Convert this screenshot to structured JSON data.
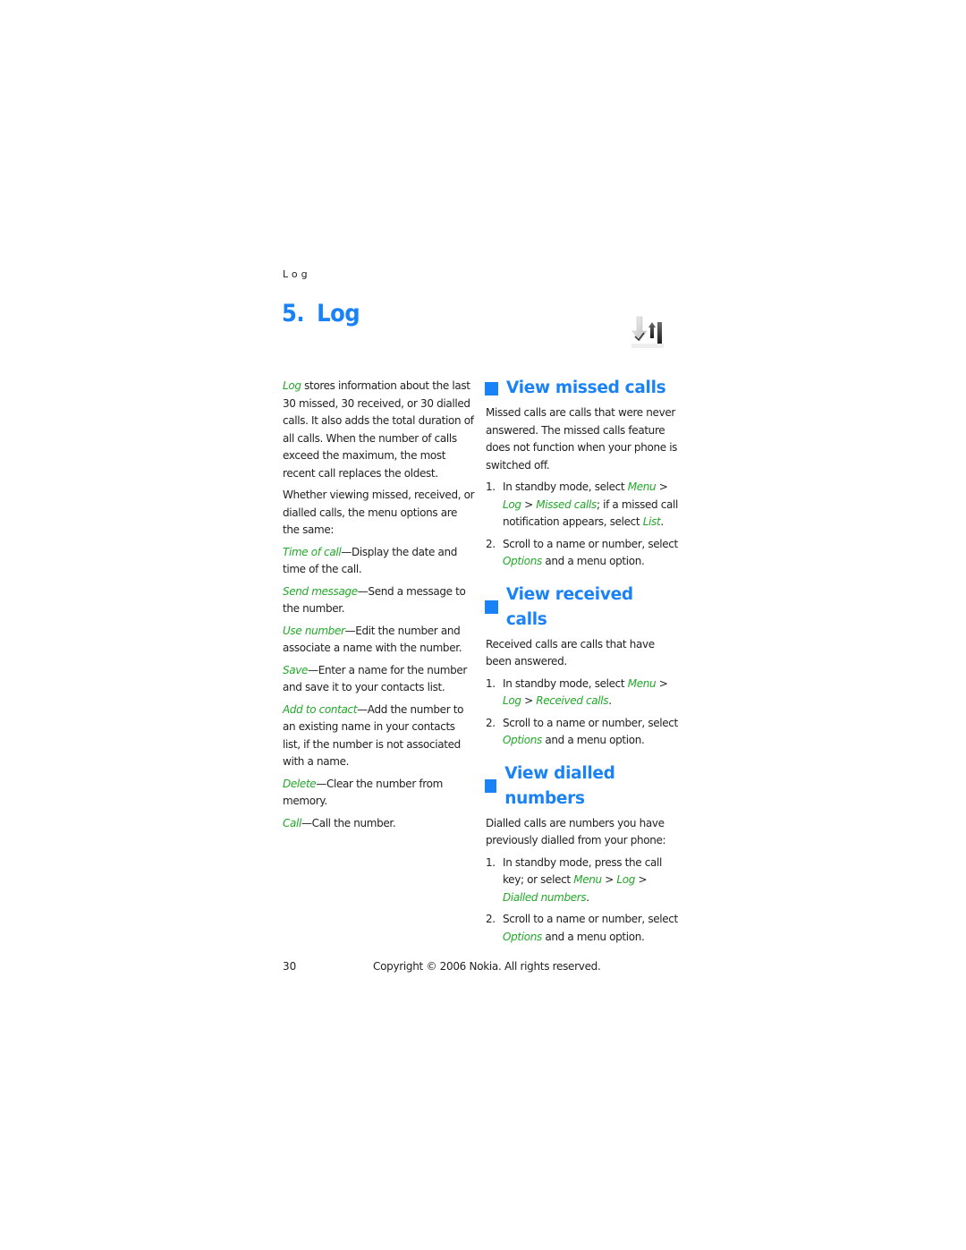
{
  "running_head": "Log",
  "chapter": {
    "number": "5.",
    "title": "Log",
    "icon": "log-arrows-icon"
  },
  "intro": {
    "p1_link": "Log",
    "p1_text": " stores information about the last 30 missed, 30 received, or 30 dialled calls. It also adds the total duration of all calls. When the number of calls exceed the maximum, the most recent call replaces the oldest.",
    "p2_text": "Whether viewing missed, received, or dialled calls, the menu options are the same:"
  },
  "options": [
    {
      "term": "Time of call",
      "desc": "—Display the date and time of the call."
    },
    {
      "term": "Send message",
      "desc": "—Send a message to the number."
    },
    {
      "term": "Use number",
      "desc": "—Edit the number and associate a name with the number."
    },
    {
      "term": "Save",
      "desc": "—Enter a name for the number and save it to your contacts list."
    },
    {
      "term": "Add to contact",
      "desc": "—Add the number to an existing name in your contacts list, if the number is not associated with a name."
    },
    {
      "term": "Delete",
      "desc": "—Clear the number from memory."
    },
    {
      "term": "Call",
      "desc": "—Call the number."
    }
  ],
  "sections": {
    "missed": {
      "heading": "View missed calls",
      "body": "Missed calls are calls that were never answered. The missed calls feature does not function when your phone is switched off.",
      "step1": {
        "n": "1.",
        "a": "In standby mode, select ",
        "menu": "Menu",
        "gt1": " > ",
        "log": "Log",
        "gt2": " > ",
        "target": "Missed calls",
        "b": "; if a missed call notification appears, select ",
        "list": "List",
        "end": "."
      },
      "step2": {
        "n": "2.",
        "a": "Scroll to a name or number, select ",
        "options": "Options",
        "b": " and a menu option."
      }
    },
    "received": {
      "heading": "View received calls",
      "body": "Received calls are calls that have been answered.",
      "step1": {
        "n": "1.",
        "a": "In standby mode, select ",
        "menu": "Menu",
        "gt1": " > ",
        "log": "Log",
        "gt2": " > ",
        "target": "Received calls",
        "end": "."
      },
      "step2": {
        "n": "2.",
        "a": "Scroll to a name or number, select ",
        "options": "Options",
        "b": " and a menu option."
      }
    },
    "dialled": {
      "heading": "View dialled numbers",
      "body": "Dialled calls are numbers you have previously dialled from your phone:",
      "step1": {
        "n": "1.",
        "a": "In standby mode, press the call key; or select ",
        "menu": "Menu",
        "gt1": " > ",
        "log": "Log",
        "gt2": " > ",
        "target": "Dialled numbers",
        "end": "."
      },
      "step2": {
        "n": "2.",
        "a": "Scroll to a name or number, select ",
        "options": "Options",
        "b": " and a menu option."
      }
    }
  },
  "footer": {
    "page_number": "30",
    "copyright": "Copyright © 2006 Nokia. All rights reserved."
  },
  "colors": {
    "heading_blue": "#1a82f7",
    "link_green": "#22a82a",
    "text": "#222222"
  }
}
